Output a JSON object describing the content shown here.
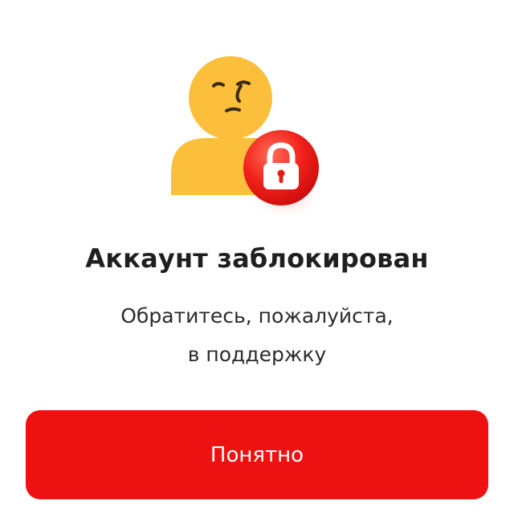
{
  "dialog": {
    "icon": "blocked-user-icon",
    "lock_icon": "lock-icon",
    "title": "Аккаунт заблокирован",
    "message_line1": "Обратитесь, пожалуйста,",
    "message_line2": "в поддержку",
    "button_label": "Понятно"
  },
  "colors": {
    "accent": "#ee1111",
    "avatar": "#fbbf3c",
    "title_text": "#1f1f1f",
    "body_text": "#2b2b2b",
    "background": "#ffffff"
  }
}
